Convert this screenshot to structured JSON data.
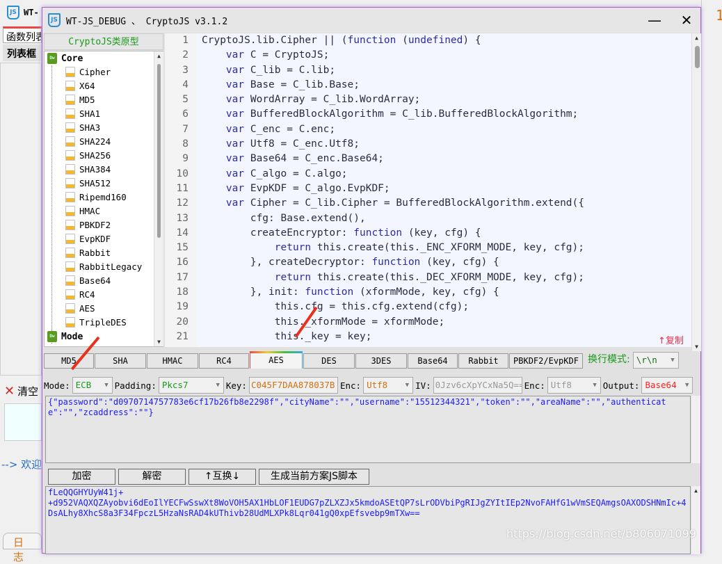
{
  "background_window": {
    "title": "WT-",
    "tab_label": "函数列表",
    "list_header": "列表框",
    "clear_label": "清空",
    "welcome_text": "--> 欢迎",
    "log_tab": "日志",
    "right_number": "1"
  },
  "window": {
    "title": "WT-JS_DEBUG 、 CryptoJS v3.1.2",
    "minimize": "—",
    "close": "✕"
  },
  "sidebar": {
    "header": "CryptoJS类原型",
    "groups": [
      {
        "label": "Core",
        "items": [
          "Cipher",
          "X64",
          "MD5",
          "SHA1",
          "SHA3",
          "SHA224",
          "SHA256",
          "SHA384",
          "SHA512",
          "Ripemd160",
          "HMAC",
          "PBKDF2",
          "EvpKDF",
          "Rabbit",
          "RabbitLegacy",
          "Base64",
          "RC4",
          "AES",
          "TripleDES"
        ]
      },
      {
        "label": "Mode",
        "items": []
      }
    ]
  },
  "editor": {
    "lines": [
      "CryptoJS.lib.Cipher || (function (undefined) {",
      "    var C = CryptoJS;",
      "    var C_lib = C.lib;",
      "    var Base = C_lib.Base;",
      "    var WordArray = C_lib.WordArray;",
      "    var BufferedBlockAlgorithm = C_lib.BufferedBlockAlgorithm;",
      "    var C_enc = C.enc;",
      "    var Utf8 = C_enc.Utf8;",
      "    var Base64 = C_enc.Base64;",
      "    var C_algo = C.algo;",
      "    var EvpKDF = C_algo.EvpKDF;",
      "    var Cipher = C_lib.Cipher = BufferedBlockAlgorithm.extend({",
      "        cfg: Base.extend(),",
      "        createEncryptor: function (key, cfg) {",
      "            return this.create(this._ENC_XFORM_MODE, key, cfg);",
      "        }, createDecryptor: function (key, cfg) {",
      "            return this.create(this._DEC_XFORM_MODE, key, cfg);",
      "        }, init: function (xformMode, key, cfg) {",
      "            this.cfg = this.cfg.extend(cfg);",
      "            this._xformMode = xformMode;",
      "            this._key = key;"
    ],
    "copy_label": "↑复制"
  },
  "tabs": [
    "MD5",
    "SHA",
    "HMAC",
    "RC4",
    "AES",
    "DES",
    "3DES",
    "Base64",
    "Rabbit",
    "PBKDF2/EvpKDF"
  ],
  "active_tab": "AES",
  "newline": {
    "label": "换行模式:",
    "value": "\\r\\n"
  },
  "options": {
    "mode_label": "Mode:",
    "mode": "ECB",
    "padding_label": "Padding:",
    "padding": "Pkcs7",
    "key_label": "Key:",
    "key": "C045F7DAA878037B",
    "enc_label": "Enc:",
    "enc": "Utf8",
    "iv_label": "IV:",
    "iv": "0Jzv6cXpYCxNa5Q==",
    "iv_enc_label": "Enc:",
    "iv_enc": "Utf8",
    "output_label": "Output:",
    "output": "Base64"
  },
  "input_text": "{\"password\":\"d0970714757783e6cf17b26fb8e2298f\",\"cityName\":\"\",\"username\":\"15512344321\",\"token\":\"\",\"areaName\":\"\",\"authenticate\":\"\",\"zcaddress\":\"\"}",
  "buttons": {
    "encrypt": "加密",
    "decrypt": "解密",
    "swap": "↑互换↓",
    "generate": "生成当前方案JS脚本"
  },
  "output_text": "fLeQQGHYUyW41j+\n+d952VAQXQZAyobvi6dEoIlYECFwSswXt8WoVOH5AX1HbLOF1EUDG7pZLXZJx5kmdoASEtQP7sLrODVbiPgRIJgZYItIEp2NvoFAHfG1wVmSEQAmgsOAXODSHNmIc+4DsALhy8XhcS8a3F34FpczL5HzaNsRAD4kUThivb28UdMLXPk8Lqr041gQ0xpEfsvebp9mTXw==",
  "watermark": "https://blog.csdn.net/b806071099",
  "colors": {
    "accent_green": "#1a9a1a",
    "keyword": "#2a2aa8",
    "text_blue": "#1a1aff",
    "key_orange": "#d07010",
    "output_red": "#ff2020"
  }
}
